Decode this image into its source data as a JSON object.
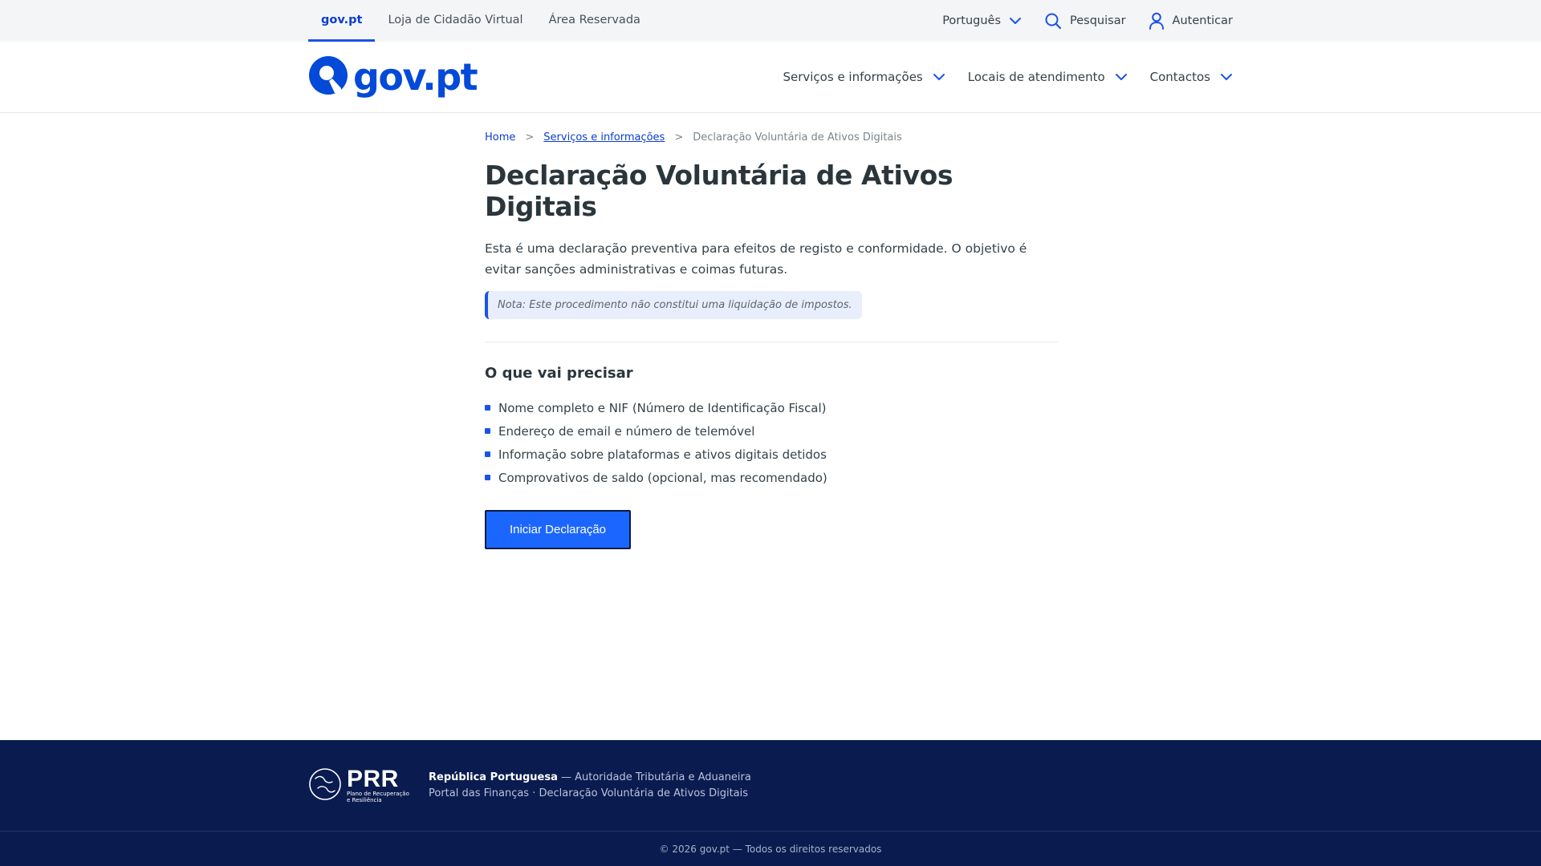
{
  "topbar": {
    "links": [
      {
        "label": "gov.pt",
        "active": true
      },
      {
        "label": "Loja de Cidadão Virtual",
        "active": false
      },
      {
        "label": "Área Reservada",
        "active": false
      }
    ],
    "language": "Português",
    "search": "Pesquisar",
    "login": "Autenticar"
  },
  "header": {
    "logo_text": "gov.pt",
    "nav": [
      {
        "label": "Serviços e informações"
      },
      {
        "label": "Locais de atendimento"
      },
      {
        "label": "Contactos"
      }
    ]
  },
  "breadcrumb": {
    "home": "Home",
    "section": "Serviços e informações",
    "current": "Declaração Voluntária de Ativos Digitais",
    "separator": ">"
  },
  "main": {
    "title": "Declaração Voluntária de Ativos Digitais",
    "lead": "Esta é uma declaração preventiva para efeitos de registo e conformidade. O objetivo é evitar sanções administrativas e coimas futuras.",
    "note": "Nota: Este procedimento não constitui uma liquidação de impostos.",
    "requirements_title": "O que vai precisar",
    "requirements": [
      "Nome completo e NIF (Número de Identificação Fiscal)",
      "Endereço de email e número de telemóvel",
      "Informação sobre plataformas e ativos digitais detidos",
      "Comprovativos de saldo (opcional, mas recomendado)"
    ],
    "cta_label": "Iniciar Declaração"
  },
  "footer": {
    "prr_logo": "PRR",
    "prr_tagline_1": "Plano de Recuperação",
    "prr_tagline_2": "e Resiliência",
    "republic": "República Portuguesa",
    "authority": " — Autoridade Tributária e Aduaneira",
    "portal_line": "Portal das Finanças · Declaração Voluntária de Ativos Digitais",
    "copyright": "© 2026 gov.pt — Todos os direitos reservados"
  },
  "colors": {
    "brand": "#034ad8",
    "accent": "#1b66ff",
    "footer_bg": "#0a1b4f",
    "topbar_bg": "#f4f5f7"
  }
}
